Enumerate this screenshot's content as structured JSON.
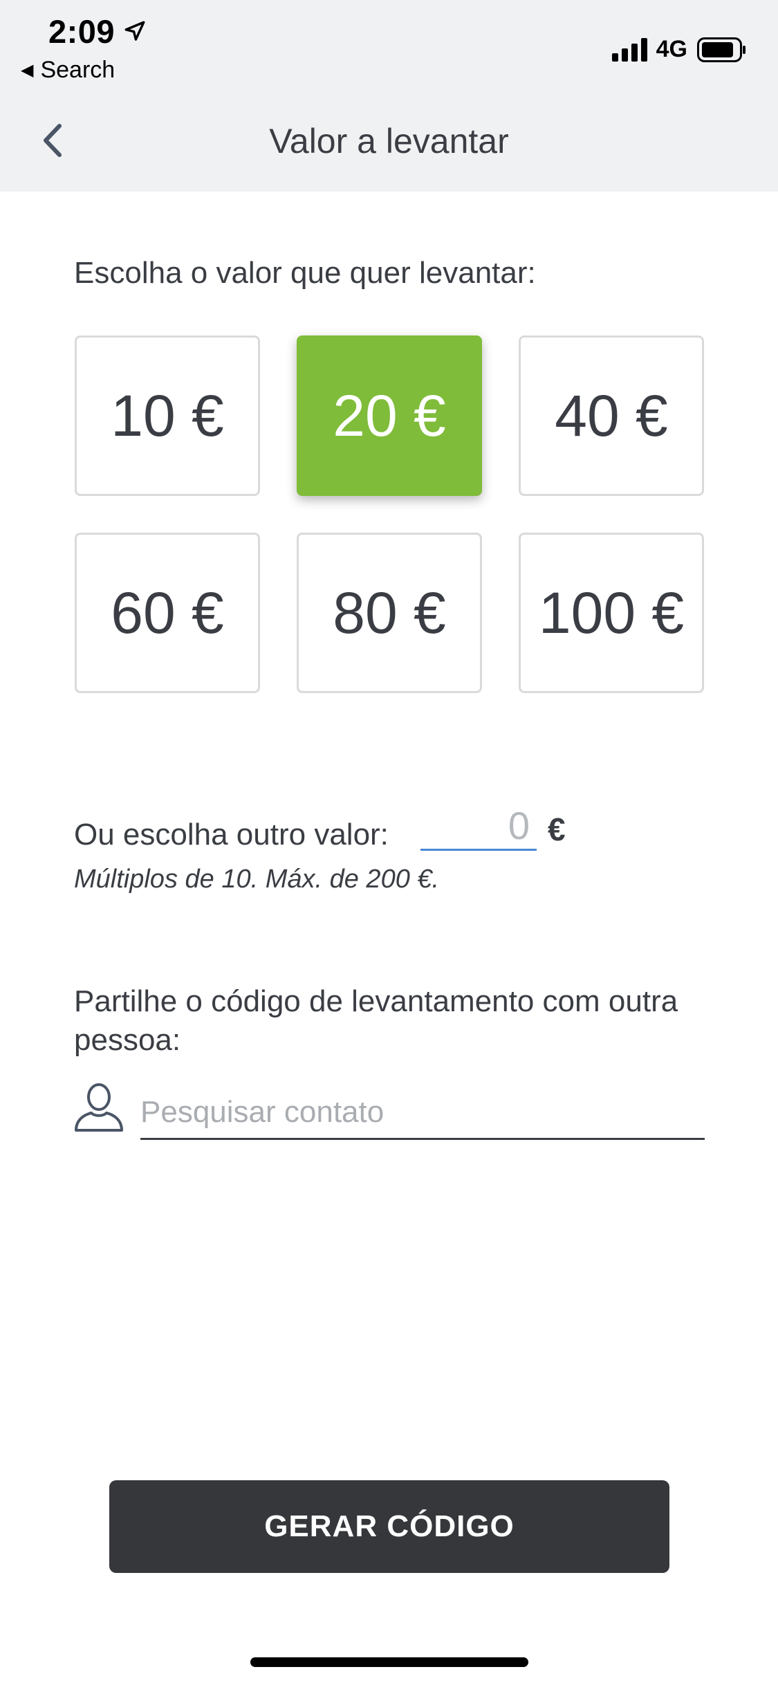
{
  "status_bar": {
    "time": "2:09",
    "back_app_label": "Search",
    "network": "4G",
    "location_icon": "location-arrow-icon",
    "signal_icon": "cellular-signal-icon",
    "battery_icon": "battery-icon"
  },
  "header": {
    "title": "Valor a levantar",
    "back_icon": "chevron-left-icon"
  },
  "amounts": {
    "prompt": "Escolha o valor que quer levantar:",
    "options": [
      "10 €",
      "20 €",
      "40 €",
      "60 €",
      "80 €",
      "100 €"
    ],
    "selected": "20 €",
    "selected_color": "#7fbc3a"
  },
  "other_value": {
    "label": "Ou escolha outro valor:",
    "placeholder": "0",
    "currency": "€",
    "hint": "Múltiplos de 10. Máx. de 200 €.",
    "underline_color": "#4a87d6"
  },
  "share": {
    "label": "Partilhe o código de levantamento com outra pessoa:",
    "search_placeholder": "Pesquisar contato",
    "contact_icon": "person-icon"
  },
  "actions": {
    "generate_label": "GERAR CÓDIGO",
    "button_color": "#35373b"
  }
}
